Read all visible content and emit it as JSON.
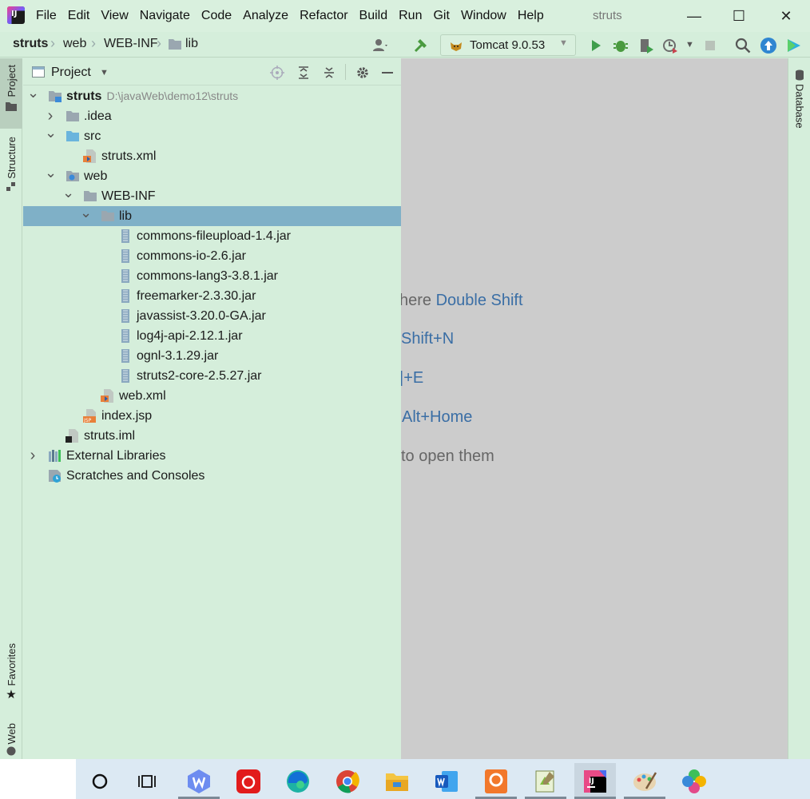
{
  "app": {
    "logo_text": "IJ",
    "window_title": "struts"
  },
  "menu": [
    {
      "label": "File"
    },
    {
      "label": "Edit"
    },
    {
      "label": "View"
    },
    {
      "label": "Navigate"
    },
    {
      "label": "Code"
    },
    {
      "label": "Analyze"
    },
    {
      "label": "Refactor"
    },
    {
      "label": "Build"
    },
    {
      "label": "Run"
    },
    {
      "label": "Git"
    },
    {
      "label": "Window"
    },
    {
      "label": "Help"
    }
  ],
  "window_controls": {
    "minimize": "—",
    "maximize": "☐",
    "close": "✕"
  },
  "breadcrumb": [
    "struts",
    "web",
    "WEB-INF",
    "lib"
  ],
  "run_config": {
    "label": "Tomcat 9.0.53"
  },
  "project_panel": {
    "title": "Project",
    "tree": [
      {
        "label": "struts",
        "path": "D:\\javaWeb\\demo12\\struts",
        "icon": "module-icon",
        "chevron": "expanded"
      },
      {
        "label": ".idea",
        "icon": "folder-icon",
        "chevron": "collapsed"
      },
      {
        "label": "src",
        "icon": "source-folder-icon",
        "chevron": "expanded"
      },
      {
        "label": "struts.xml",
        "icon": "xml-file-icon"
      },
      {
        "label": "web",
        "icon": "web-folder-icon",
        "chevron": "expanded"
      },
      {
        "label": "WEB-INF",
        "icon": "folder-icon",
        "chevron": "expanded"
      },
      {
        "label": "lib",
        "icon": "folder-icon",
        "chevron": "expanded",
        "selected": true
      },
      {
        "label": "commons-fileupload-1.4.jar",
        "icon": "jar-icon"
      },
      {
        "label": "commons-io-2.6.jar",
        "icon": "jar-icon"
      },
      {
        "label": "commons-lang3-3.8.1.jar",
        "icon": "jar-icon"
      },
      {
        "label": "freemarker-2.3.30.jar",
        "icon": "jar-icon"
      },
      {
        "label": "javassist-3.20.0-GA.jar",
        "icon": "jar-icon"
      },
      {
        "label": "log4j-api-2.12.1.jar",
        "icon": "jar-icon"
      },
      {
        "label": "ognl-3.1.29.jar",
        "icon": "jar-icon"
      },
      {
        "label": "struts2-core-2.5.27.jar",
        "icon": "jar-icon"
      },
      {
        "label": "web.xml",
        "icon": "xml-file-icon"
      },
      {
        "label": "index.jsp",
        "icon": "jsp-file-icon"
      },
      {
        "label": "struts.iml",
        "icon": "iml-file-icon"
      },
      {
        "label": "External Libraries",
        "icon": "libraries-icon",
        "chevron": "collapsed"
      },
      {
        "label": "Scratches and Consoles",
        "icon": "scratches-icon"
      }
    ]
  },
  "editor_hints": [
    {
      "muted": "here ",
      "key": "Double Shift"
    },
    {
      "muted": "",
      "key": "Shift+N"
    },
    {
      "muted": "",
      "key": "|+E"
    },
    {
      "muted": "",
      "key": "Alt+Home"
    },
    {
      "muted": "to open them",
      "key": ""
    }
  ],
  "left_tabs": {
    "project": "Project",
    "structure": "Structure",
    "favorites": "Favorites",
    "web": "Web"
  },
  "right_tabs": {
    "database": "Database"
  },
  "colors": {
    "panel_bg": "#d5eedb",
    "selection": "#7fb0c7",
    "editor_bg": "#cccccc",
    "hint_key": "#3a6ea5"
  }
}
